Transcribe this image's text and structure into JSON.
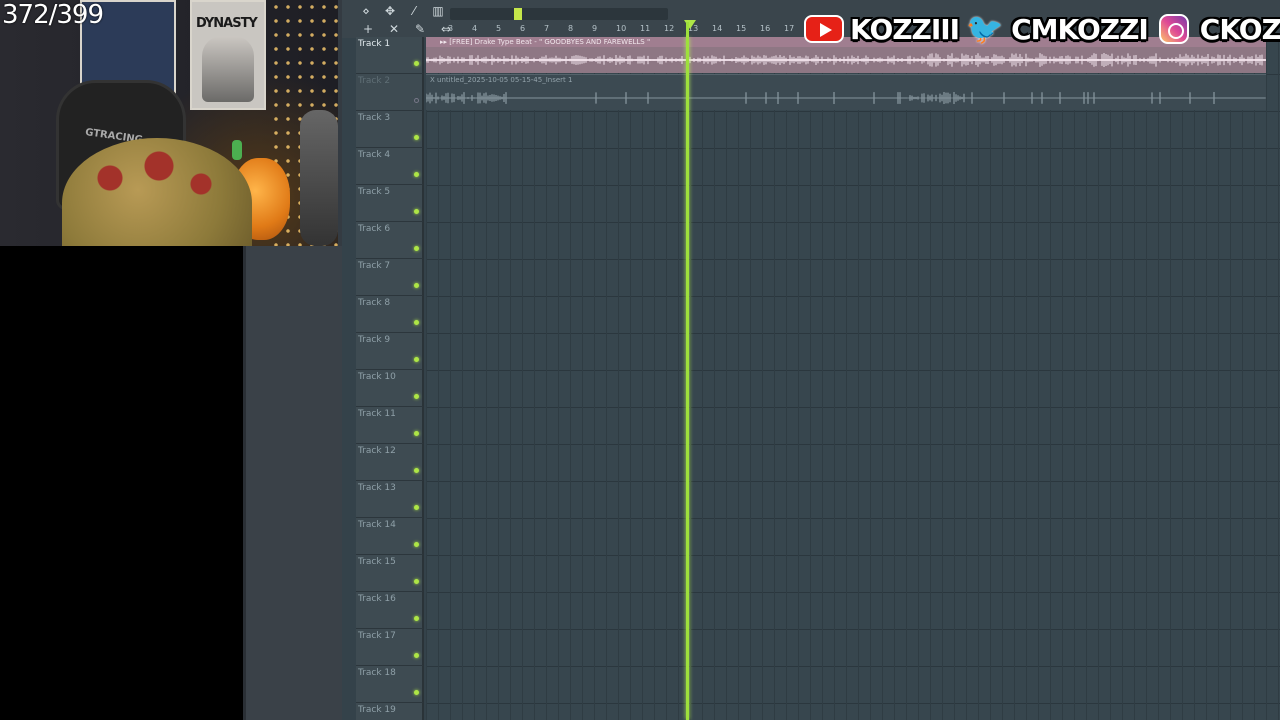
{
  "overlay": {
    "counter": "372/399",
    "socials": [
      {
        "icon": "youtube-icon",
        "handle": "KOZZIII"
      },
      {
        "icon": "twitter-icon",
        "handle": "CMKOZZI"
      },
      {
        "icon": "instagram-icon",
        "handle": "CKOZZI"
      }
    ]
  },
  "webcam": {
    "poster_title": "DYNASTY",
    "chair_text": "GTRACING"
  },
  "toolbar": {
    "icons": [
      "magnet-icon",
      "draw-icon",
      "paint-icon",
      "delete-icon",
      "zoom-icon"
    ],
    "row2_icons": [
      "plus-icon",
      "close-icon",
      "pencil-icon",
      "arrows-icon"
    ]
  },
  "ruler": {
    "labels": [
      "3",
      "4",
      "5",
      "6",
      "7",
      "8",
      "9",
      "10",
      "11",
      "12",
      "13",
      "14",
      "15",
      "16",
      "17"
    ]
  },
  "clips": {
    "clip1_title": "▸▸ [FREE] Drake Type Beat - \" GOODBYES AND FAREWELLS \"",
    "clip2_title": "X untitled_2025-10-05 05-15-45_Insert 1"
  },
  "tracks": [
    {
      "name": "Track 1",
      "state": "active"
    },
    {
      "name": "Track 2",
      "state": "muted"
    },
    {
      "name": "Track 3",
      "state": "normal"
    },
    {
      "name": "Track 4",
      "state": "normal"
    },
    {
      "name": "Track 5",
      "state": "normal"
    },
    {
      "name": "Track 6",
      "state": "normal"
    },
    {
      "name": "Track 7",
      "state": "normal"
    },
    {
      "name": "Track 8",
      "state": "normal"
    },
    {
      "name": "Track 9",
      "state": "normal"
    },
    {
      "name": "Track 10",
      "state": "normal"
    },
    {
      "name": "Track 11",
      "state": "normal"
    },
    {
      "name": "Track 12",
      "state": "normal"
    },
    {
      "name": "Track 13",
      "state": "normal"
    },
    {
      "name": "Track 14",
      "state": "normal"
    },
    {
      "name": "Track 15",
      "state": "normal"
    },
    {
      "name": "Track 16",
      "state": "normal"
    },
    {
      "name": "Track 17",
      "state": "normal"
    },
    {
      "name": "Track 18",
      "state": "normal"
    },
    {
      "name": "Track 19",
      "state": "normal"
    }
  ],
  "colors": {
    "playhead": "#9ee03c",
    "clip1": "#8e7784",
    "youtube": "#e62117",
    "twitter": "#1da1f2"
  }
}
